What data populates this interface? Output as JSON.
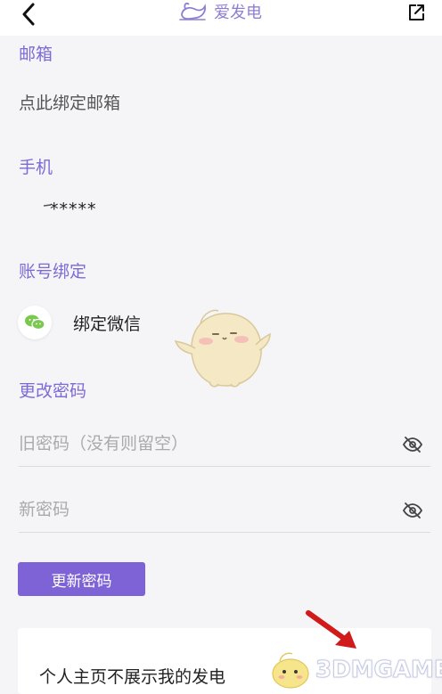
{
  "header": {
    "title": "爱发电",
    "back_icon": "chevron-left-icon",
    "share_icon": "external-link-icon",
    "accent": "#8f7fd2"
  },
  "email": {
    "label": "邮箱",
    "value": "点此绑定邮箱"
  },
  "phone": {
    "label": "手机",
    "value": "*****"
  },
  "account_binding": {
    "label": "账号绑定",
    "wechat_label": "绑定微信",
    "wechat_icon": "wechat-icon"
  },
  "password": {
    "label": "更改密码",
    "old_placeholder": "旧密码（没有则留空）",
    "new_placeholder": "新密码",
    "eye_icon": "eye-off-icon",
    "update_button": "更新密码",
    "button_color": "#7e63d6"
  },
  "privacy_card": {
    "label": "个人主页不展示我的发电"
  },
  "watermark": {
    "text": "3DMGAME"
  }
}
